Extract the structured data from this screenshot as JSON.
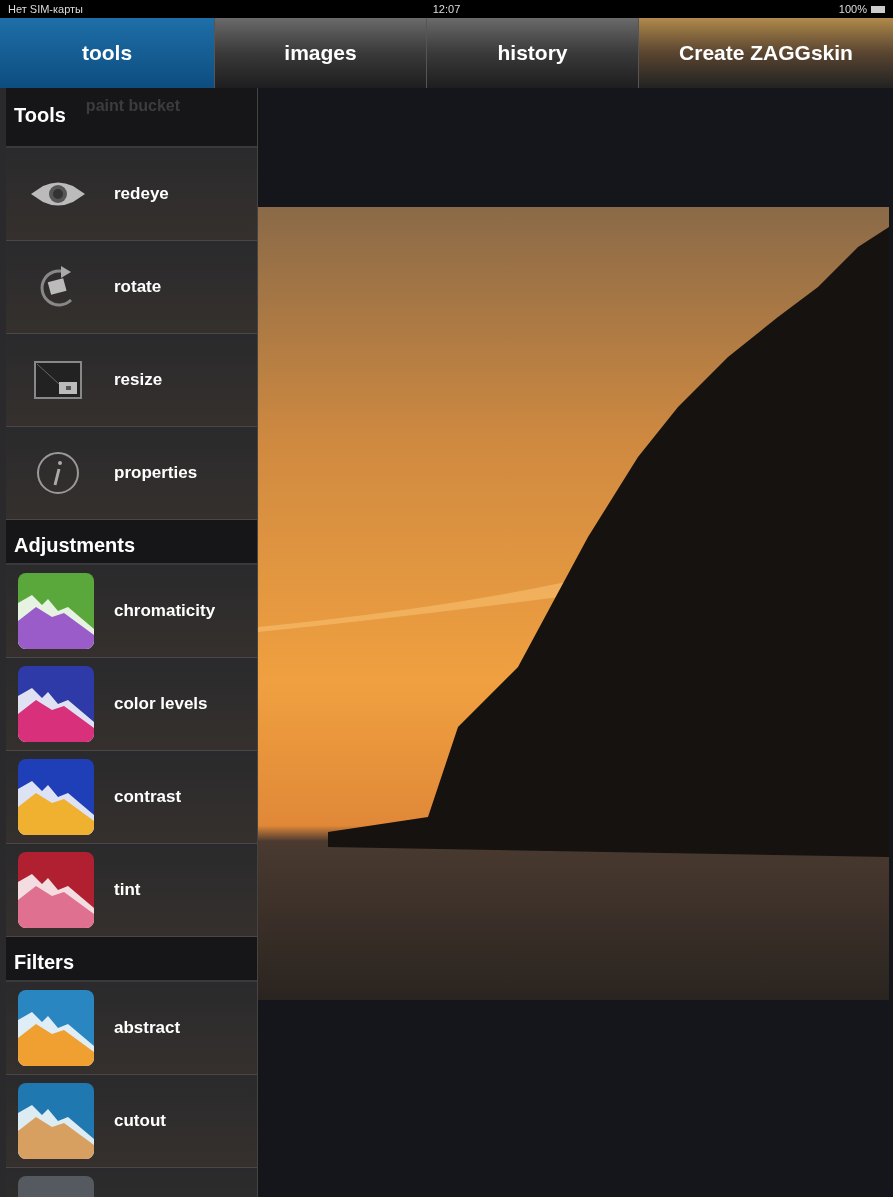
{
  "status_bar": {
    "carrier": "Нет SIM-карты",
    "time": "12:07",
    "battery": "100%"
  },
  "tabs": [
    {
      "label": "tools",
      "selected": true
    },
    {
      "label": "images",
      "selected": false
    },
    {
      "label": "history",
      "selected": false
    }
  ],
  "action_button": {
    "label": "Create ZAGGskin"
  },
  "sidebar": {
    "scrolled_item": "paint bucket",
    "sections": [
      {
        "title": "Tools",
        "items": [
          {
            "kind": "eye",
            "label": "redeye"
          },
          {
            "kind": "rotate",
            "label": "rotate"
          },
          {
            "kind": "resize",
            "label": "resize"
          },
          {
            "kind": "info",
            "label": "properties"
          }
        ]
      },
      {
        "title": "Adjustments",
        "items": [
          {
            "kind": "thumb",
            "label": "chromaticity",
            "color": "#5aa83c"
          },
          {
            "kind": "thumb",
            "label": "color levels",
            "color": "#2e3aa8"
          },
          {
            "kind": "thumb",
            "label": "contrast",
            "color": "#1f3fb8"
          },
          {
            "kind": "thumb",
            "label": "tint",
            "color": "#b02030"
          }
        ]
      },
      {
        "title": "Filters",
        "items": [
          {
            "kind": "thumb",
            "label": "abstract",
            "color": "#2a86c0"
          },
          {
            "kind": "thumb",
            "label": "cutout",
            "color": "#1f78b0"
          },
          {
            "kind": "thumb",
            "color": "#555a60"
          }
        ]
      }
    ]
  }
}
